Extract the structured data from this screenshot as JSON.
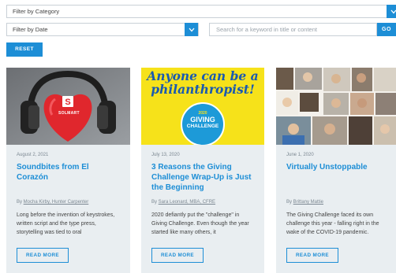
{
  "filters": {
    "category_label": "Filter by Category",
    "date_label": "Filter by Date",
    "search_placeholder": "Search for a keyword in title or content",
    "go_label": "GO",
    "reset_label": "RESET"
  },
  "cards": [
    {
      "date": "August 2, 2021",
      "title": "Soundbites from El Corazón",
      "byline_prefix": "By ",
      "authors": "Mocha Kirby, Hunter Carpenter",
      "description": "Long before the invention of keystrokes, written script and the type press, storytelling was tied to oral",
      "button": "READ MORE",
      "image_text": "SOLMART",
      "image_icon": "heart-headphones-image"
    },
    {
      "date": "July 13, 2020",
      "title": "3 Reasons the Giving Challenge Wrap-Up is Just the Beginning",
      "byline_prefix": "By ",
      "authors": "Sara Leonard, MBA, CFRE",
      "description": "2020 defiantly put the \"challenge\" in Giving Challenge. Even though the year started like many others, it",
      "button": "READ MORE",
      "image_headline": "Anyone can be a philanthropist!",
      "badge_year": "2020",
      "badge_line1": "GIVING",
      "badge_line2": "CHALLENGE"
    },
    {
      "date": "June 1, 2020",
      "title": "Virtually Unstoppable",
      "byline_prefix": "By ",
      "authors": "Brittany Mattie",
      "description": "The Giving Challenge faced its own challenge this year - falling right in the wake of the COVID-19 pandemic.",
      "button": "READ MORE",
      "image_icon": "photo-collage-image"
    }
  ],
  "colors": {
    "accent": "#1d8ed6",
    "card_bg": "#e9eef1",
    "banner_yellow": "#f6e21a"
  }
}
